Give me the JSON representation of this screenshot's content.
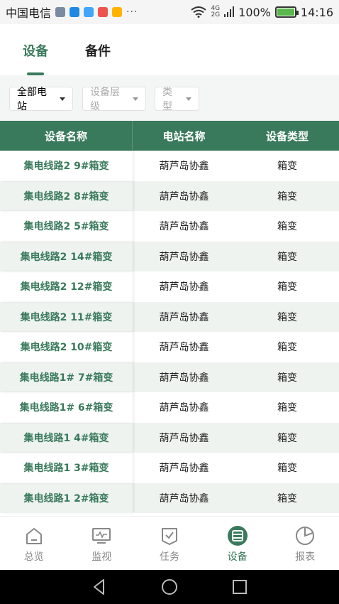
{
  "status_bar": {
    "carrier": "中国电信",
    "dots": "···",
    "network": [
      "4G",
      "2G"
    ],
    "battery": "100%",
    "time": "14:16"
  },
  "tabs": [
    {
      "label": "设备",
      "active": true
    },
    {
      "label": "备件",
      "active": false
    }
  ],
  "filters": [
    {
      "label": "全部电站",
      "enabled": true
    },
    {
      "label": "设备层级",
      "enabled": false
    },
    {
      "label": "类型",
      "enabled": false
    }
  ],
  "table": {
    "headers": [
      "设备名称",
      "电站名称",
      "设备类型"
    ],
    "rows": [
      [
        "集电线路2 9#箱变",
        "葫芦岛协鑫",
        "箱变"
      ],
      [
        "集电线路2 8#箱变",
        "葫芦岛协鑫",
        "箱变"
      ],
      [
        "集电线路2 5#箱变",
        "葫芦岛协鑫",
        "箱变"
      ],
      [
        "集电线路2 14#箱变",
        "葫芦岛协鑫",
        "箱变"
      ],
      [
        "集电线路2 12#箱变",
        "葫芦岛协鑫",
        "箱变"
      ],
      [
        "集电线路2 11#箱变",
        "葫芦岛协鑫",
        "箱变"
      ],
      [
        "集电线路2 10#箱变",
        "葫芦岛协鑫",
        "箱变"
      ],
      [
        "集电线路1# 7#箱变",
        "葫芦岛协鑫",
        "箱变"
      ],
      [
        "集电线路1# 6#箱变",
        "葫芦岛协鑫",
        "箱变"
      ],
      [
        "集电线路1 4#箱变",
        "葫芦岛协鑫",
        "箱变"
      ],
      [
        "集电线路1 3#箱变",
        "葫芦岛协鑫",
        "箱变"
      ],
      [
        "集电线路1 2#箱变",
        "葫芦岛协鑫",
        "箱变"
      ]
    ]
  },
  "bottom_nav": [
    {
      "label": "总览",
      "icon": "home-icon",
      "active": false
    },
    {
      "label": "监视",
      "icon": "monitor-icon",
      "active": false
    },
    {
      "label": "任务",
      "icon": "task-icon",
      "active": false
    },
    {
      "label": "设备",
      "icon": "device-icon",
      "active": true
    },
    {
      "label": "报表",
      "icon": "report-icon",
      "active": false
    }
  ],
  "colors": {
    "primary": "#3a7a5c",
    "row_alt": "#eef3f0",
    "inactive": "#888888"
  }
}
